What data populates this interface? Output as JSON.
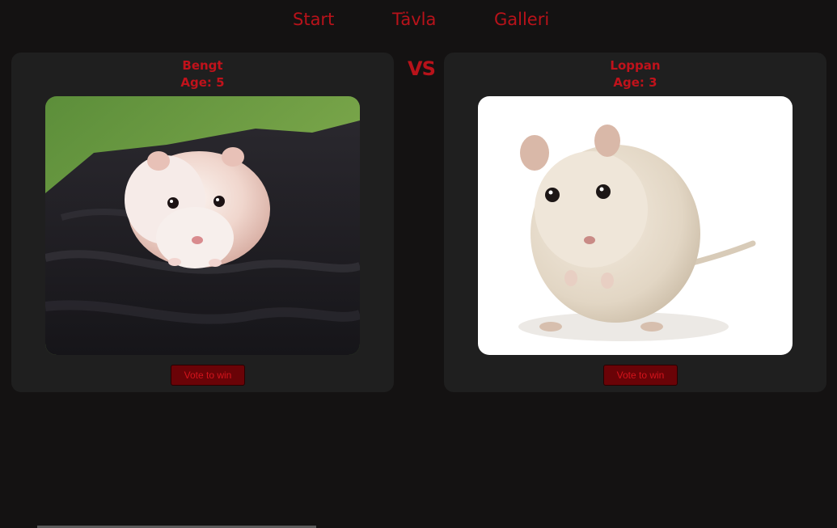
{
  "nav": {
    "items": [
      {
        "label": "Start"
      },
      {
        "label": "Tävla"
      },
      {
        "label": "Galleri"
      }
    ]
  },
  "versus_label": "VS",
  "contestants": [
    {
      "name": "Bengt",
      "age_label": "Age:",
      "age": "5",
      "vote_label": "Vote to win",
      "photo": "hamster-photo"
    },
    {
      "name": "Loppan",
      "age_label": "Age:",
      "age": "3",
      "vote_label": "Vote to win",
      "photo": "gerbil-photo"
    }
  ],
  "colors": {
    "background": "#141212",
    "card": "#1f1f1f",
    "accent": "#b8121a",
    "button": "#6a0307"
  }
}
